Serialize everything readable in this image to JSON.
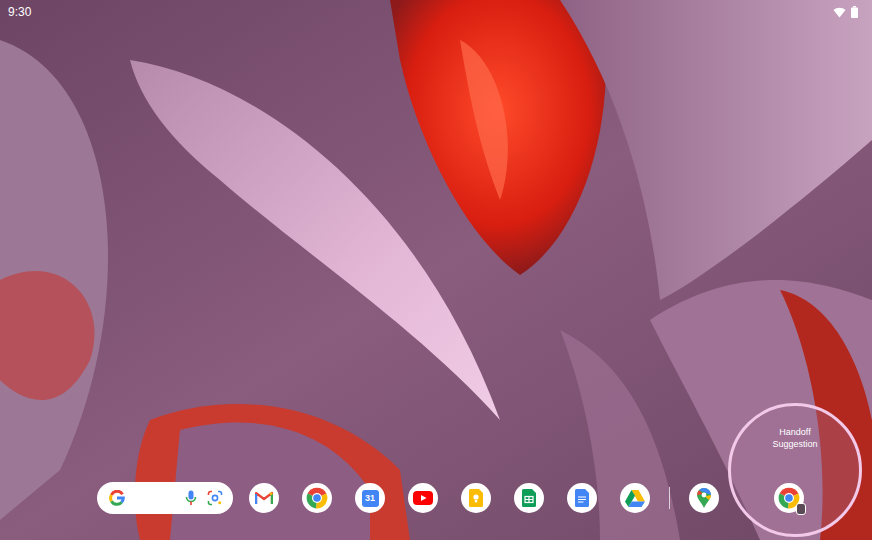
{
  "status_bar": {
    "time": "9:30",
    "wifi": true,
    "battery": true
  },
  "search": {
    "voice": true,
    "lens": true
  },
  "taskbar": {
    "apps": [
      {
        "kind": "gmail",
        "label": ""
      },
      {
        "kind": "chrome",
        "label": ""
      },
      {
        "kind": "calendar",
        "label": "31"
      },
      {
        "kind": "youtube",
        "label": ""
      },
      {
        "kind": "keep",
        "label": ""
      },
      {
        "kind": "sheets",
        "label": ""
      },
      {
        "kind": "docs",
        "label": ""
      },
      {
        "kind": "drive",
        "label": ""
      },
      {
        "kind": "divider",
        "label": ""
      },
      {
        "kind": "maps",
        "label": ""
      }
    ]
  },
  "handoff": {
    "label": "Handoff Suggestion",
    "kind": "chrome",
    "highlighted": true
  }
}
